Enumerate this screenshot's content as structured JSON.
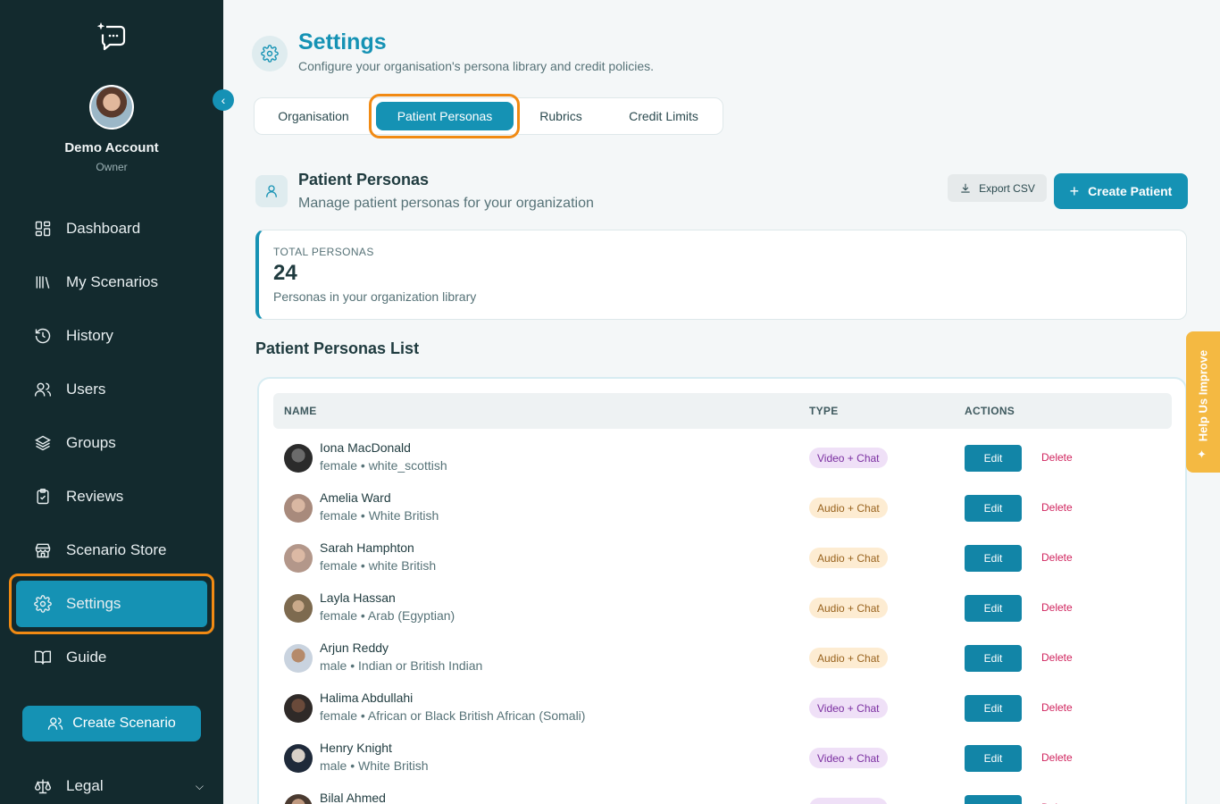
{
  "sidebar": {
    "account_name": "Demo Account",
    "account_role": "Owner",
    "nav": [
      {
        "label": "Dashboard",
        "icon": "dashboard-icon"
      },
      {
        "label": "My Scenarios",
        "icon": "library-icon"
      },
      {
        "label": "History",
        "icon": "history-icon"
      },
      {
        "label": "Users",
        "icon": "users-icon"
      },
      {
        "label": "Groups",
        "icon": "layers-icon"
      },
      {
        "label": "Reviews",
        "icon": "clipboard-check-icon"
      },
      {
        "label": "Scenario Store",
        "icon": "store-icon"
      },
      {
        "label": "Settings",
        "icon": "gear-icon",
        "active": true
      },
      {
        "label": "Guide",
        "icon": "book-icon"
      }
    ],
    "create_scenario_label": "Create Scenario",
    "legal_label": "Legal"
  },
  "header": {
    "title": "Settings",
    "subtitle": "Configure your organisation's persona library and credit policies."
  },
  "tabs": [
    {
      "label": "Organisation"
    },
    {
      "label": "Patient Personas",
      "active": true
    },
    {
      "label": "Rubrics"
    },
    {
      "label": "Credit Limits"
    }
  ],
  "section": {
    "title": "Patient Personas",
    "subtitle": "Manage patient personas for your organization",
    "export_label": "Export CSV",
    "create_label": "Create Patient"
  },
  "stats": {
    "label": "TOTAL PERSONAS",
    "value": "24",
    "description": "Personas in your organization library"
  },
  "list": {
    "title": "Patient Personas List",
    "columns": [
      "NAME",
      "TYPE",
      "ACTIONS"
    ],
    "edit_label": "Edit",
    "delete_label": "Delete",
    "rows": [
      {
        "name": "Iona MacDonald",
        "meta": "female • white_scottish",
        "type": "Video + Chat",
        "kind": "video"
      },
      {
        "name": "Amelia Ward",
        "meta": "female • White British",
        "type": "Audio + Chat",
        "kind": "audio"
      },
      {
        "name": "Sarah Hamphton",
        "meta": "female • white British",
        "type": "Audio + Chat",
        "kind": "audio"
      },
      {
        "name": "Layla Hassan",
        "meta": "female • Arab (Egyptian)",
        "type": "Audio + Chat",
        "kind": "audio"
      },
      {
        "name": "Arjun Reddy",
        "meta": "male • Indian or British Indian",
        "type": "Audio + Chat",
        "kind": "audio"
      },
      {
        "name": "Halima Abdullahi",
        "meta": "female • African or Black British African (Somali)",
        "type": "Video + Chat",
        "kind": "video"
      },
      {
        "name": "Henry Knight",
        "meta": "male • White British",
        "type": "Video + Chat",
        "kind": "video"
      },
      {
        "name": "Bilal Ahmed",
        "meta": "",
        "type": "Video + Chat",
        "kind": "video"
      }
    ]
  },
  "help_tab_label": "Help Us Improve",
  "colors": {
    "accent": "#1592b4",
    "sidebar": "#132a2e",
    "highlight": "#f18a13",
    "delete": "#d0245e"
  }
}
